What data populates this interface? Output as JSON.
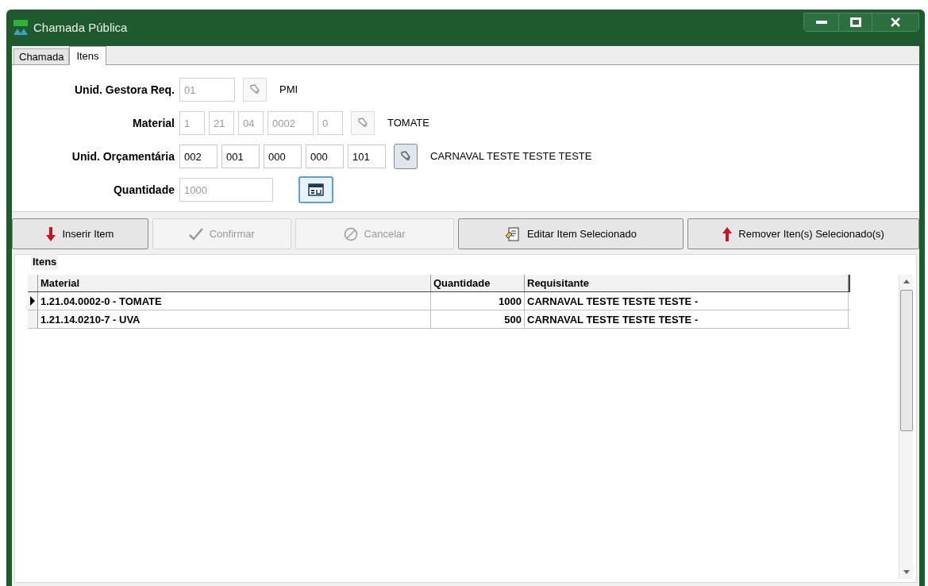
{
  "window": {
    "title": "Chamada Pública"
  },
  "tabs": [
    {
      "label": "Chamada",
      "selected": false
    },
    {
      "label": "Itens",
      "selected": true
    }
  ],
  "fields": [
    {
      "label": "Unid. Gestora Req.",
      "parts": [
        {
          "value": "01",
          "disabled": true
        }
      ],
      "button": {
        "kind": "lookup",
        "disabled": true
      },
      "description": "PMI"
    },
    {
      "label": "Material",
      "parts": [
        {
          "value": "1",
          "disabled": true
        },
        {
          "value": "21",
          "disabled": true
        },
        {
          "value": "04",
          "disabled": true
        },
        {
          "value": "0002",
          "disabled": true
        },
        {
          "value": "0",
          "disabled": true
        }
      ],
      "button": {
        "kind": "lookup",
        "disabled": true
      },
      "description": "TOMATE"
    },
    {
      "label": "Unid. Orçamentária",
      "parts": [
        {
          "value": "002",
          "disabled": false
        },
        {
          "value": "001",
          "disabled": false
        },
        {
          "value": "000",
          "disabled": false
        },
        {
          "value": "000",
          "disabled": false
        },
        {
          "value": "101",
          "disabled": false
        }
      ],
      "button": {
        "kind": "lookup",
        "disabled": false
      },
      "description": "CARNAVAL TESTE TESTE TESTE"
    },
    {
      "label": "Quantidade",
      "parts": [
        {
          "value": "1000",
          "disabled": true
        }
      ],
      "button": {
        "kind": "calculator"
      }
    }
  ],
  "actions": [
    {
      "label": "Inserir Item",
      "kind": "down",
      "disabled": false
    },
    {
      "label": "Confirmar",
      "kind": "check",
      "disabled": true
    },
    {
      "label": "Cancelar",
      "kind": "cancel",
      "disabled": true
    },
    {
      "label": "Editar Item Selecionado",
      "kind": "edit",
      "disabled": false
    },
    {
      "label": "Remover Iten(s) Selecionado(s)",
      "kind": "up",
      "disabled": false
    }
  ],
  "group": {
    "title": "Itens"
  },
  "table": {
    "columns": [
      "Material",
      "Quantidade",
      "Requisitante"
    ],
    "rows": [
      {
        "cells": [
          "1.21.04.0002-0 - TOMATE",
          "1000",
          "CARNAVAL TESTE TESTE TESTE -"
        ],
        "selected": true
      },
      {
        "cells": [
          "1.21.14.0210-7 - UVA",
          "500",
          "CARNAVAL TESTE TESTE TESTE -"
        ],
        "selected": false
      }
    ]
  }
}
